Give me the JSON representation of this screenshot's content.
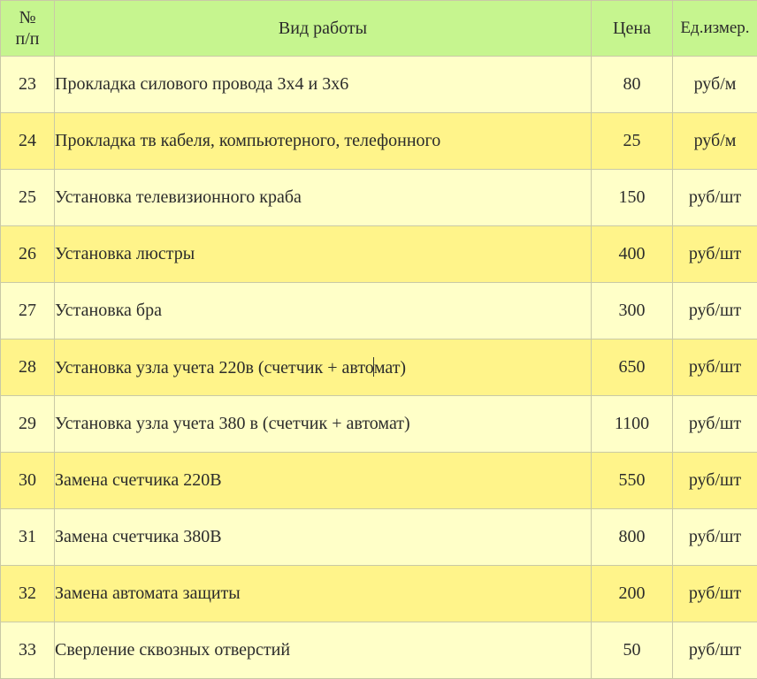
{
  "header": {
    "num_label_line1": "№",
    "num_label_line2": "п/п",
    "name_label": "Вид работы",
    "price_label": "Цена",
    "unit_label": "Ед.измер."
  },
  "rows": [
    {
      "num": "23",
      "name": "Прокладка силового провода 3х4 и 3х6",
      "price": "80",
      "unit": "руб/м"
    },
    {
      "num": "24",
      "name": "Прокладка тв кабеля, компьютерного, телефонного",
      "price": "25",
      "unit": "руб/м"
    },
    {
      "num": "25",
      "name": "Установка телевизионного краба",
      "price": "150",
      "unit": "руб/шт"
    },
    {
      "num": "26",
      "name": "Установка люстры",
      "price": "400",
      "unit": "руб/шт"
    },
    {
      "num": "27",
      "name": "Установка бра",
      "price": "300",
      "unit": "руб/шт"
    },
    {
      "num": "28",
      "name_before_cursor": "Установка узла учета 220в (счетчик + авто",
      "name_after_cursor": "мат)",
      "price": "650",
      "unit": "руб/шт"
    },
    {
      "num": "29",
      "name": "Установка узла учета 380 в (счетчик + автомат)",
      "price": "1100",
      "unit": "руб/шт"
    },
    {
      "num": "30",
      "name": "Замена счетчика 220В",
      "price": "550",
      "unit": "руб/шт"
    },
    {
      "num": "31",
      "name": "Замена счетчика 380В",
      "price": "800",
      "unit": "руб/шт"
    },
    {
      "num": "32",
      "name": "Замена автомата защиты",
      "price": "200",
      "unit": "руб/шт"
    },
    {
      "num": "33",
      "name": "Сверление сквозных отверстий",
      "price": "50",
      "unit": "руб/шт"
    }
  ],
  "colors": {
    "header_bg": "#c6f58f",
    "row_light_bg": "#ffffc8",
    "row_dark_bg": "#fff48a",
    "border": "#c9c9a6"
  }
}
